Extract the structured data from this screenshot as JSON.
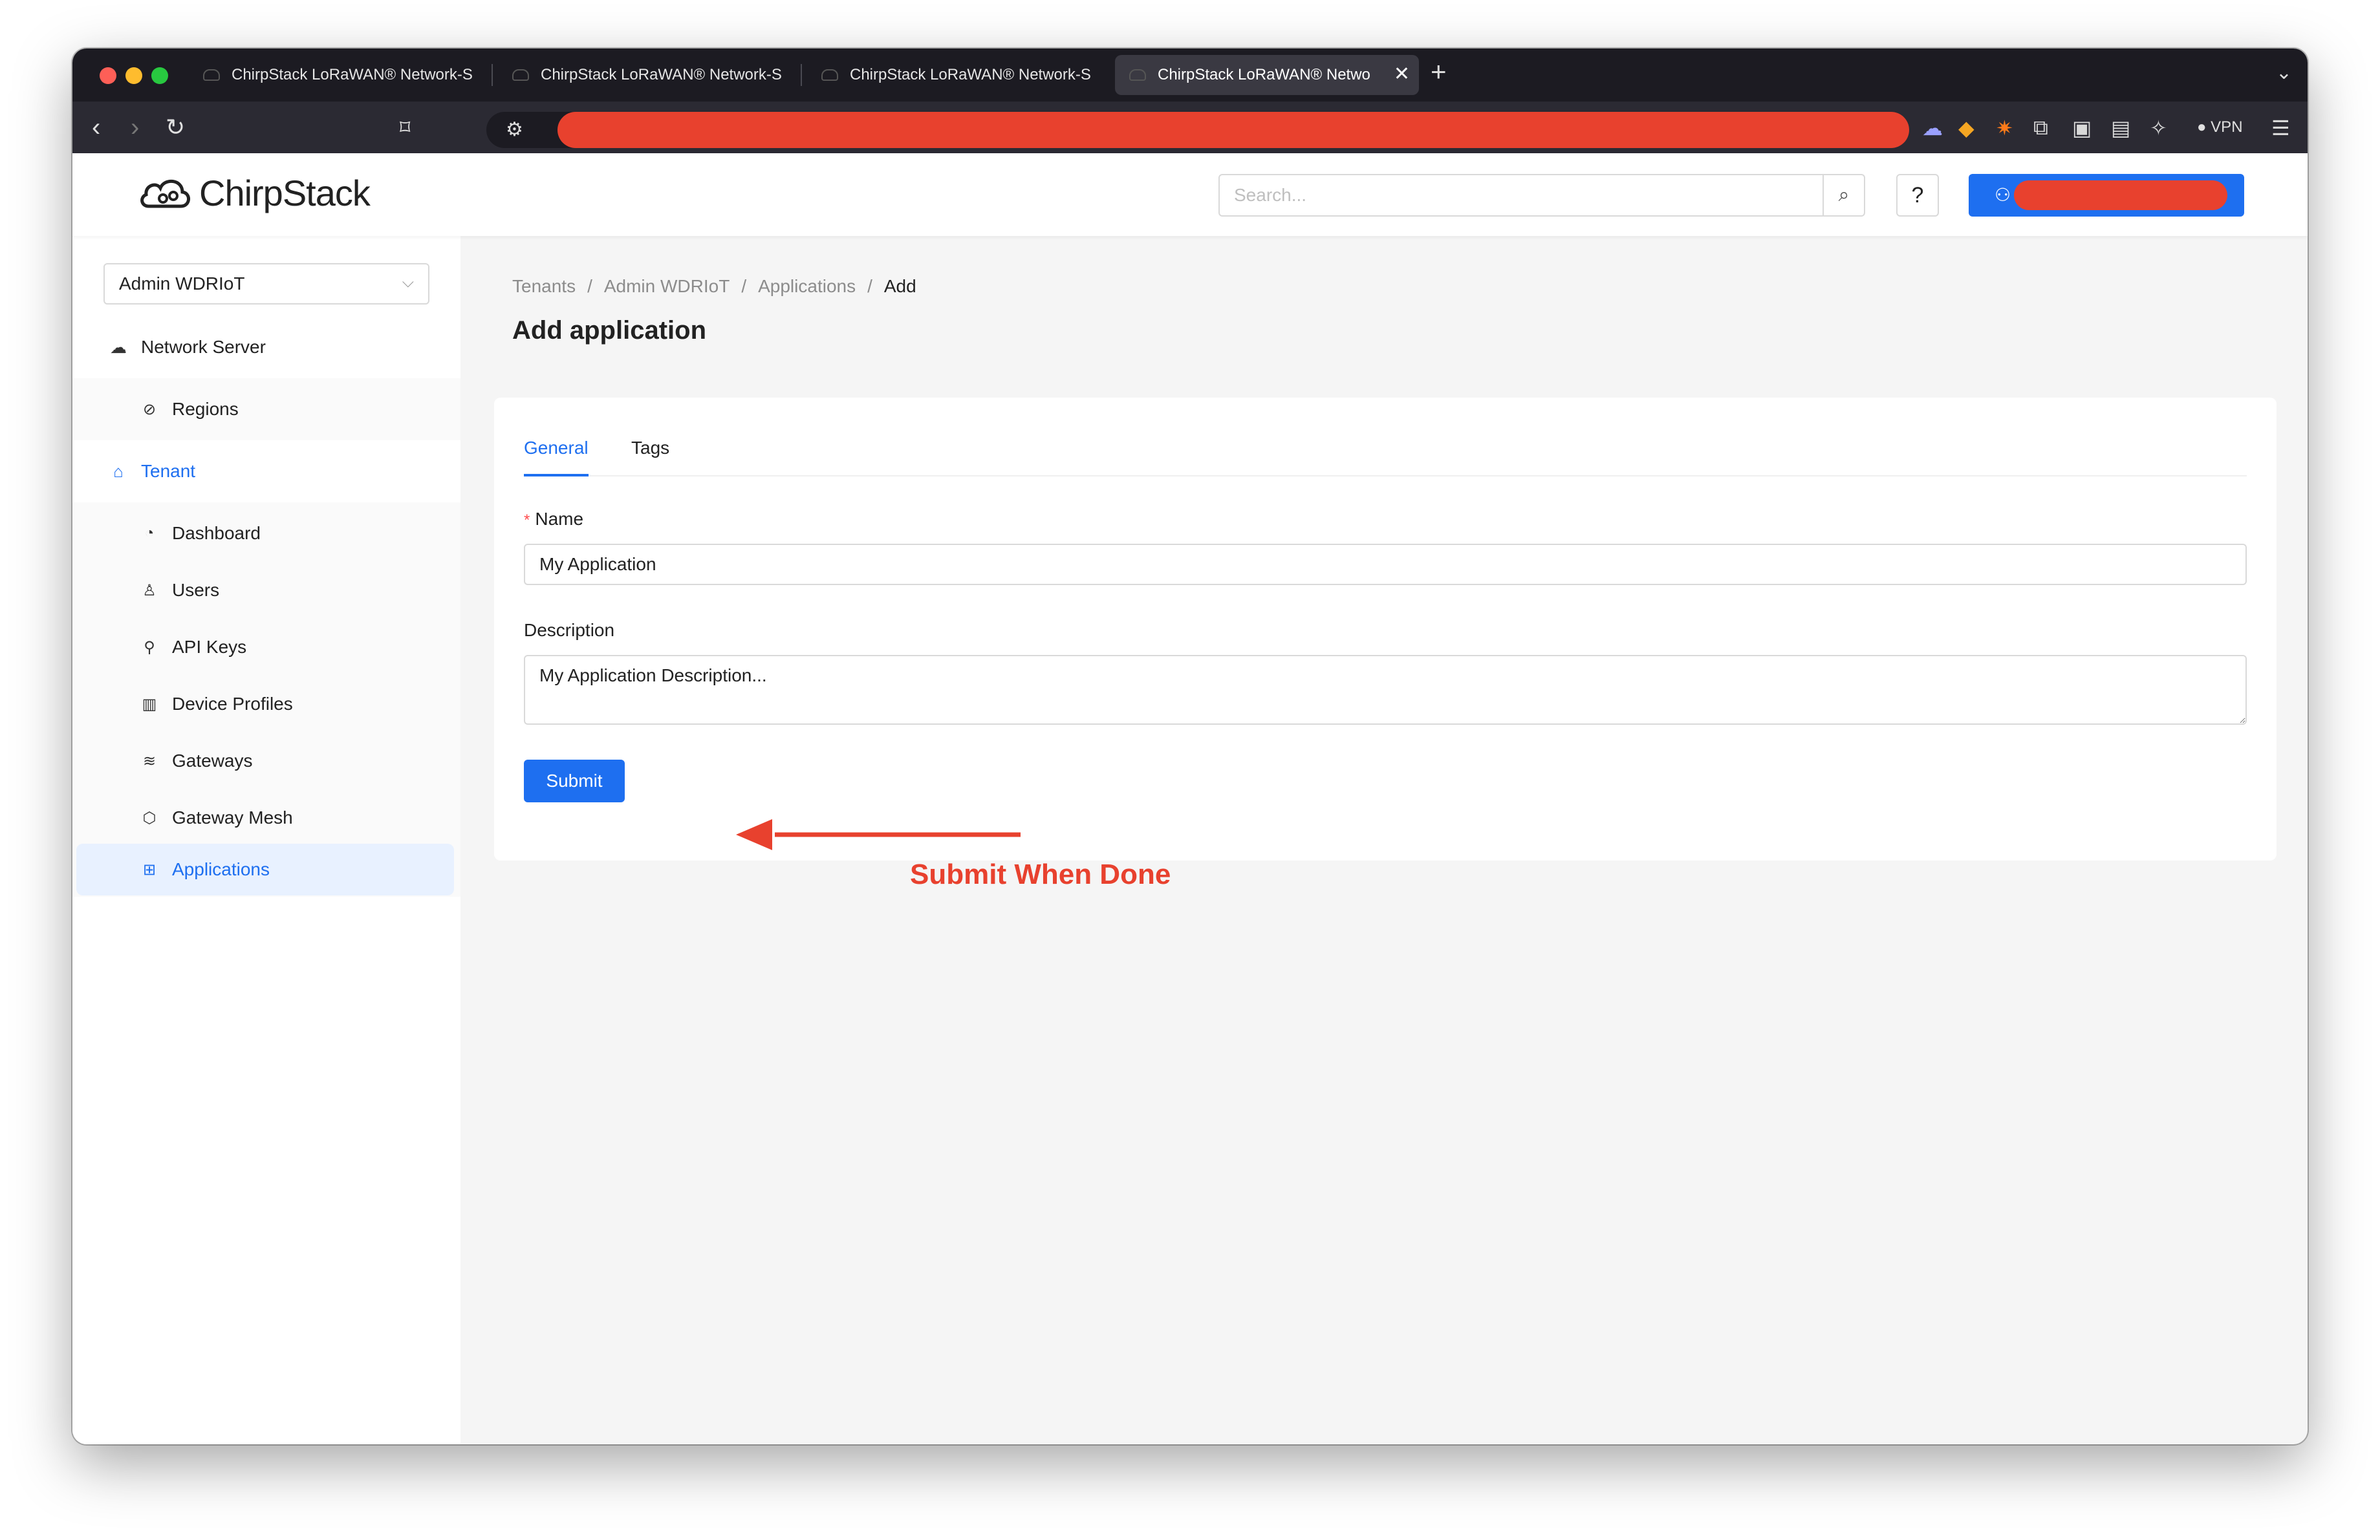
{
  "browser": {
    "tabs": [
      {
        "label": "ChirpStack LoRaWAN® Network-S"
      },
      {
        "label": "ChirpStack LoRaWAN® Network-S"
      },
      {
        "label": "ChirpStack LoRaWAN® Network-S"
      },
      {
        "label": "ChirpStack LoRaWAN® Netwo"
      }
    ],
    "vpn_label": "VPN"
  },
  "header": {
    "logo_text": "ChirpStack",
    "search_placeholder": "Search...",
    "help_label": "?"
  },
  "sidebar": {
    "tenant_select": "Admin WDRIoT",
    "network_server": "Network Server",
    "regions": "Regions",
    "tenant": "Tenant",
    "items": [
      {
        "label": "Dashboard",
        "icon": "dashboard-icon"
      },
      {
        "label": "Users",
        "icon": "user-icon"
      },
      {
        "label": "API Keys",
        "icon": "key-icon"
      },
      {
        "label": "Device Profiles",
        "icon": "device-profiles-icon"
      },
      {
        "label": "Gateways",
        "icon": "wifi-icon"
      },
      {
        "label": "Gateway Mesh",
        "icon": "mesh-icon"
      },
      {
        "label": "Applications",
        "icon": "applications-icon"
      }
    ]
  },
  "main": {
    "breadcrumb": [
      "Tenants",
      "Admin WDRIoT",
      "Applications",
      "Add"
    ],
    "title": "Add application",
    "tabs": [
      "General",
      "Tags"
    ],
    "name_label": "Name",
    "name_value": "My Application",
    "description_label": "Description",
    "description_value": "My Application Description...",
    "submit_label": "Submit"
  },
  "annotation": {
    "text": "Submit When Done",
    "color": "#e8412e"
  },
  "colors": {
    "primary": "#1e6ff0",
    "redaction": "#e8412e"
  }
}
